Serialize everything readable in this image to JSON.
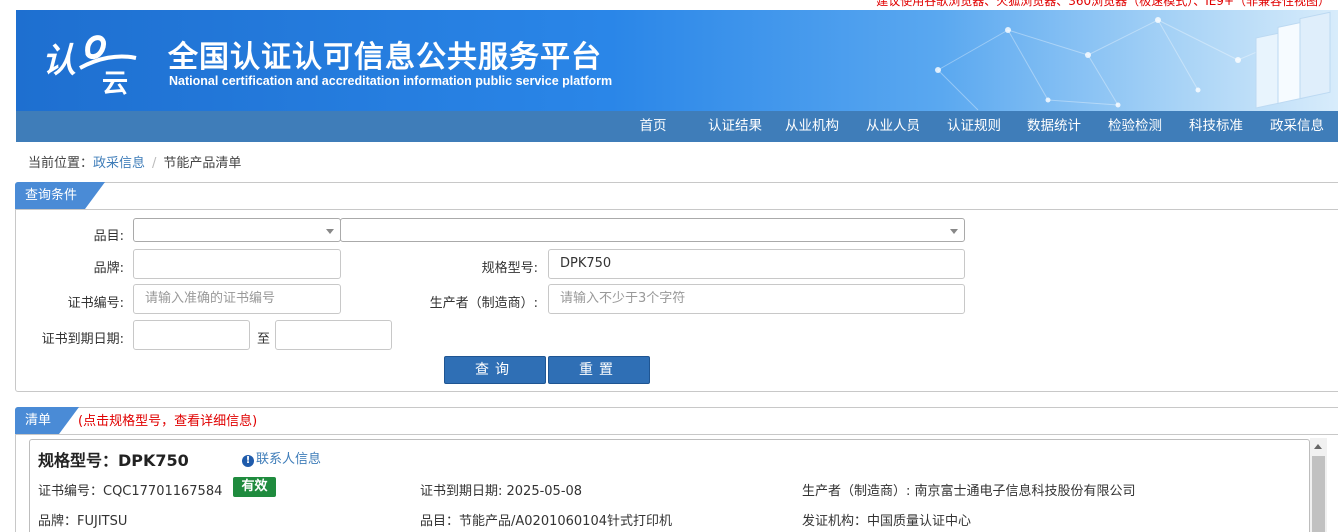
{
  "notice": "建议使用谷歌浏览器、火狐浏览器、360浏览器（极速模式）、IE9+（非兼容性视图）",
  "header": {
    "title": "全国认证认可信息公共服务平台",
    "subtitle": "National certification and accreditation information public service platform",
    "logo_text": "认证云"
  },
  "nav": [
    "首页",
    "认证结果",
    "从业机构",
    "从业人员",
    "认证规则",
    "数据统计",
    "检验检测",
    "科技标准",
    "政采信息"
  ],
  "breadcrumb": {
    "label": "当前位置：",
    "link": "政采信息",
    "current": "节能产品清单"
  },
  "query": {
    "tab": "查询条件",
    "category_label": "品目:",
    "category_value": "",
    "subcategory_value": "",
    "brand_label": "品牌:",
    "brand_value": "",
    "model_label": "规格型号:",
    "model_value": "DPK750",
    "cert_no_label": "证书编号:",
    "cert_no_placeholder": "请输入准确的证书编号",
    "manufacturer_label": "生产者（制造商）:",
    "manufacturer_placeholder": "请输入不少于3个字符",
    "expiry_label": "证书到期日期:",
    "expiry_from": "",
    "expiry_to": "",
    "to_label": "至",
    "search_button": "查询",
    "reset_button": "重置"
  },
  "list": {
    "tab": "清单",
    "note": "(点击规格型号，查看详细信息)",
    "items": [
      {
        "title": "规格型号：DPK750",
        "contact": "联系人信息",
        "cert_no": "证书编号：CQC17701167584",
        "status": "有效",
        "expiry": "证书到期日期: 2025-05-08",
        "manufacturer": "生产者（制造商）: 南京富士通电子信息科技股份有限公司",
        "brand": "品牌：FUJITSU",
        "category": "品目：节能产品/A0201060104针式打印机",
        "issuer": "发证机构：中国质量认证中心"
      }
    ]
  },
  "colors": {
    "nav_bg": "#3f7db9",
    "tab_bg": "#4a8bd6",
    "button_bg": "#2f6fb5",
    "status_green": "#1f8b3e",
    "note_red": "#e00000"
  }
}
